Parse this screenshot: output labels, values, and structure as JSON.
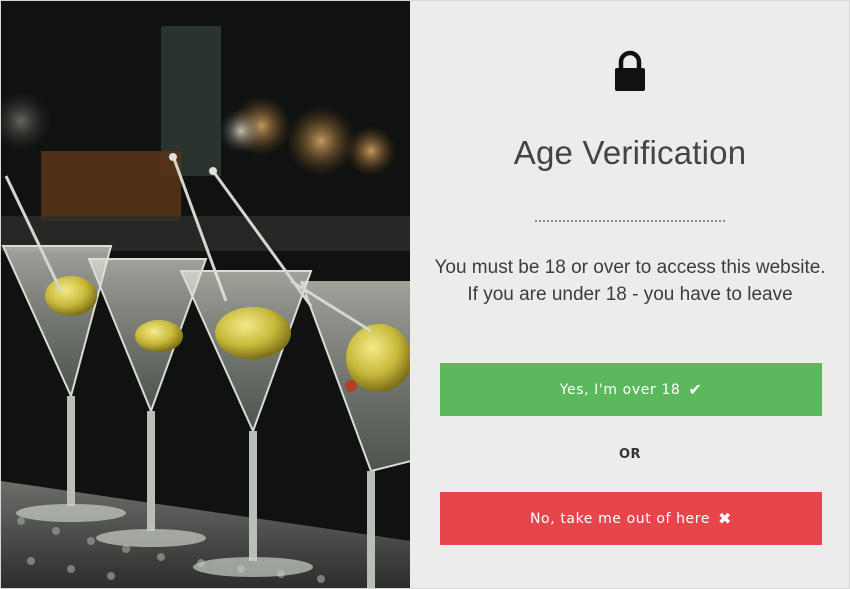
{
  "modal": {
    "title": "Age Verification",
    "message": "You must be 18 or over to access this website. If you are under 18 - you have to leave",
    "confirm_button": {
      "label": "Yes, I'm over 18",
      "icon": "checkmark-icon",
      "color": "#5cb85c"
    },
    "separator_text": "OR",
    "deny_button": {
      "label": "No, take me out of here",
      "icon": "x-icon",
      "color": "#e7454c"
    },
    "lock_icon": "lock-icon",
    "panel_background": "#ececec"
  },
  "photo": {
    "subject": "martini-glasses-with-olives"
  }
}
